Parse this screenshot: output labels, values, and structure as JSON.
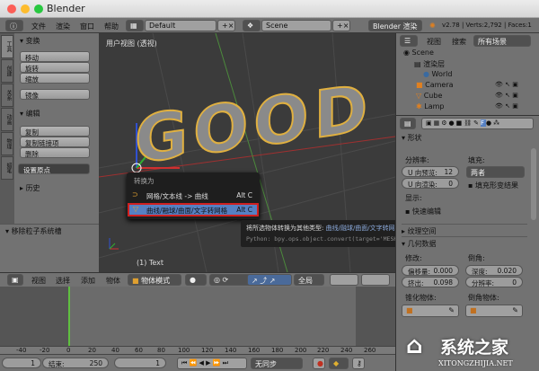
{
  "window": {
    "title": "Blender"
  },
  "menubar": {
    "items": [
      "文件",
      "渲染",
      "窗口",
      "帮助"
    ],
    "layout": "Default",
    "scene": "Scene",
    "engine": "Blender 渲染",
    "stats": "v2.78 | Verts:2,792 | Faces:1"
  },
  "shelf": {
    "tabs": [
      "工具",
      "创建",
      "关系",
      "动画",
      "物理",
      "蜡笔"
    ],
    "transform": {
      "title": "变换",
      "buttons": [
        "移动",
        "旋转",
        "缩放",
        "镜像"
      ]
    },
    "edit": {
      "title": "编辑",
      "buttons": [
        "复制",
        "复制链接项",
        "删除"
      ],
      "origin": "设置原点"
    },
    "history": {
      "title": "历史"
    }
  },
  "particle_panel": {
    "title": "移除粒子系统槽"
  },
  "viewport": {
    "label": "用户视图 (透视)",
    "object": "(1) Text",
    "text3d": "GOOD"
  },
  "menu": {
    "title": "转换为",
    "items": [
      {
        "label": "网格/文本线 -> 曲线",
        "shortcut": "Alt C"
      },
      {
        "label": "曲线/融球/曲面/文字转网格",
        "shortcut": "Alt C"
      }
    ]
  },
  "tooltip": {
    "text": "将所选物体转换为其他类型: ",
    "highlight": "曲线/融球/曲面/文字转网格",
    "python": "Python: bpy.ops.object.convert(target='MESH')"
  },
  "header3d": {
    "items": [
      "视图",
      "选择",
      "添加",
      "物体"
    ],
    "mode": "物体模式",
    "orientation": "全局"
  },
  "timeline": {
    "ticks": [
      "-40",
      "-20",
      "0",
      "20",
      "40",
      "60",
      "80",
      "100",
      "120",
      "140",
      "160",
      "180",
      "200",
      "220",
      "240",
      "260"
    ],
    "start": "1",
    "end_label": "结束:",
    "end": "250",
    "current": "1",
    "sync": "无同步"
  },
  "outliner": {
    "view": "视图",
    "search": "搜索",
    "filter": "所有场景",
    "rows": [
      "Scene",
      "渲染层",
      "World",
      "Camera",
      "Cube",
      "Lamp"
    ]
  },
  "props": {
    "shape": "形状",
    "resolution": "分辨率:",
    "u_preview": "U 向预览:",
    "u_preview_val": "12",
    "u_render": "U 向渲染:",
    "u_render_val": "0",
    "fill": "填充:",
    "fill_val": "两者",
    "fill_deform": "填充形变结果",
    "display": "显示:",
    "fast_edit": "快速编辑",
    "texture_space": "纹理空间",
    "geometry": "几何数据",
    "modify": "修改:",
    "offset": "偏移量:",
    "offset_val": "0.000",
    "extrude": "挤出:",
    "extrude_val": "0.098",
    "bevel": "倒角:",
    "depth": "深度:",
    "depth_val": "0.020",
    "bevel_res": "分辨率:",
    "bevel_res_val": "0",
    "taper": "锥化物体:",
    "bevel_obj": "倒角物体:"
  },
  "watermark": {
    "name": "系统之家",
    "url": "XITONGZHIJIA.NET"
  },
  "colors": {
    "accent": "#5680c2",
    "highlight_border": "#d02020",
    "text_gold": "#e0b040"
  }
}
